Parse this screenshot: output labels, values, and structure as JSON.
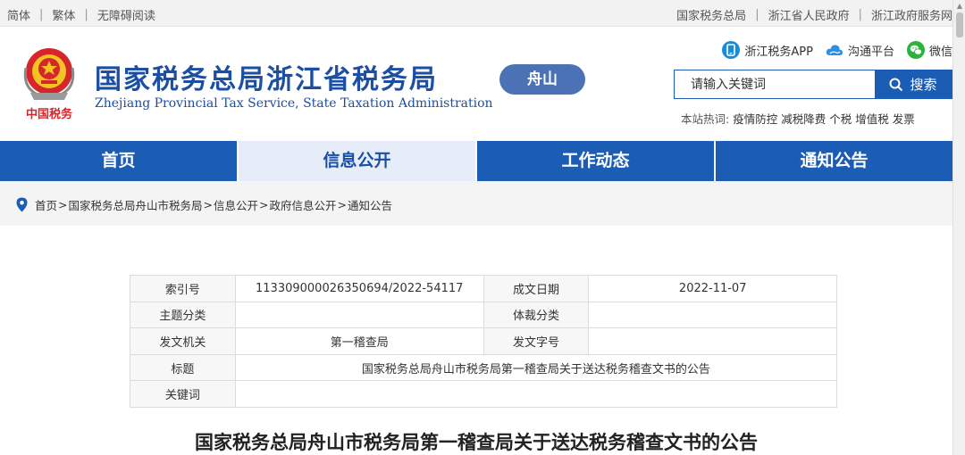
{
  "topbar": {
    "left": [
      "简体",
      "繁体",
      "无障碍阅读"
    ],
    "right": [
      "国家税务总局",
      "浙江省人民政府",
      "浙江政府服务网"
    ]
  },
  "header": {
    "emblem_text": "中国税务",
    "title": "国家税务总局浙江省税务局",
    "subtitle": "Zhejiang Provincial Tax Service, State Taxation Administration",
    "city": "舟山",
    "quick_links": [
      {
        "label": "浙江税务APP",
        "icon": "mobile-app-icon",
        "color": "#1b8bd6"
      },
      {
        "label": "沟通平台",
        "icon": "cloud-icon",
        "color": "#2d8fe6"
      },
      {
        "label": "微信",
        "icon": "wechat-icon",
        "color": "#2bb33c"
      }
    ],
    "search": {
      "placeholder": "请输入关键词",
      "button": "搜索"
    },
    "hot_label": "本站热词:",
    "hot_words": [
      "疫情防控",
      "减税降费",
      "个税",
      "增值税",
      "发票"
    ]
  },
  "nav": {
    "items": [
      "首页",
      "信息公开",
      "工作动态",
      "通知公告"
    ],
    "active": 1
  },
  "breadcrumb": [
    "首页",
    "国家税务总局舟山市税务局",
    "信息公开",
    "政府信息公开",
    "通知公告"
  ],
  "info": {
    "index_label": "索引号",
    "index_value": "113309000026350694/2022-54117",
    "date_label": "成文日期",
    "date_value": "2022-11-07",
    "topic_label": "主题分类",
    "topic_value": "",
    "genre_label": "体裁分类",
    "genre_value": "",
    "issuer_label": "发文机关",
    "issuer_value": "第一稽查局",
    "docno_label": "发文字号",
    "docno_value": "",
    "title_label": "标题",
    "title_value": "国家税务总局舟山市税务局第一稽查局关于送达税务稽查文书的公告",
    "keywords_label": "关键词",
    "keywords_value": ""
  },
  "article": {
    "title": "国家税务总局舟山市税务局第一稽查局关于送达税务稽查文书的公告"
  },
  "colors": {
    "brand_blue": "#1b5cb5",
    "title_blue": "#1b4fa3",
    "badge_blue": "#4a72b5",
    "nav_active_bg": "#e6edf8"
  }
}
